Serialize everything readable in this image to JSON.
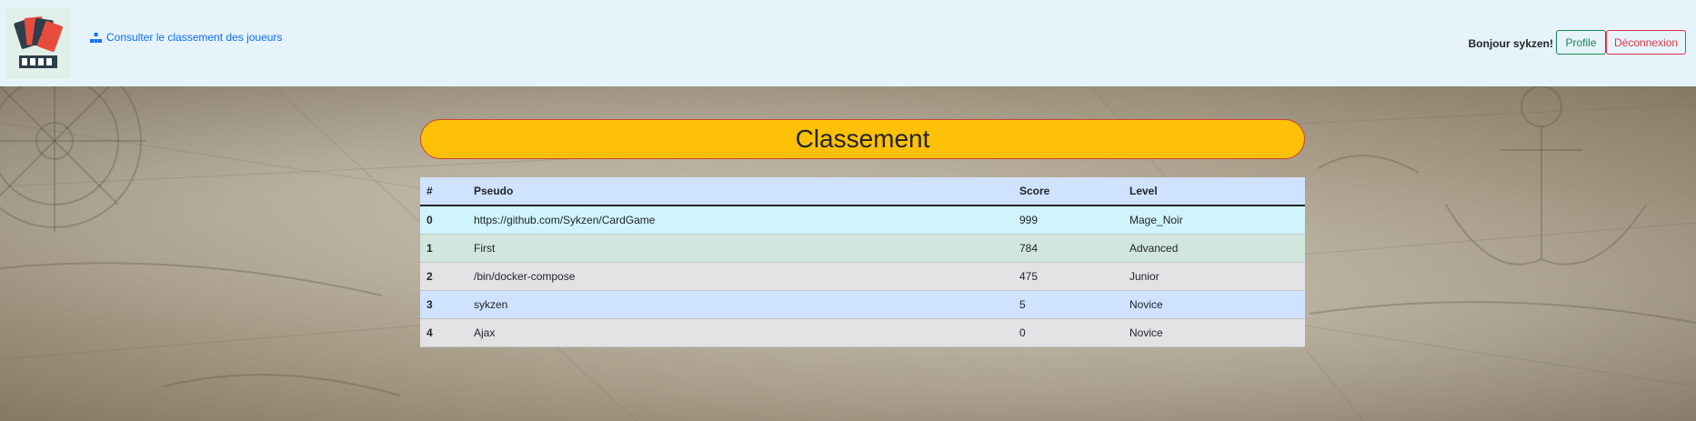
{
  "navbar": {
    "logo_icon": "playing-cards-logo",
    "rank_link_icon": "hierarchy-icon",
    "rank_link_label": "Consulter le classement des joueurs",
    "greeting": "Bonjour sykzen!",
    "profile_button": "Profile",
    "logout_button": "Déconnexion"
  },
  "colors": {
    "accent": "#ffc107",
    "link": "#0d6efd",
    "profile": "#198754",
    "logout": "#dc3545"
  },
  "main": {
    "title": "Classement",
    "table": {
      "columns": [
        "#",
        "Pseudo",
        "Score",
        "Level"
      ],
      "rows": [
        {
          "index": "0",
          "pseudo": "https://github.com/Sykzen/CardGame",
          "score": "999",
          "level": "Mage_Noir"
        },
        {
          "index": "1",
          "pseudo": "First",
          "score": "784",
          "level": "Advanced"
        },
        {
          "index": "2",
          "pseudo": "/bin/docker-compose",
          "score": "475",
          "level": "Junior"
        },
        {
          "index": "3",
          "pseudo": "sykzen",
          "score": "5",
          "level": "Novice"
        },
        {
          "index": "4",
          "pseudo": "Ajax",
          "score": "0",
          "level": "Novice"
        }
      ]
    }
  }
}
